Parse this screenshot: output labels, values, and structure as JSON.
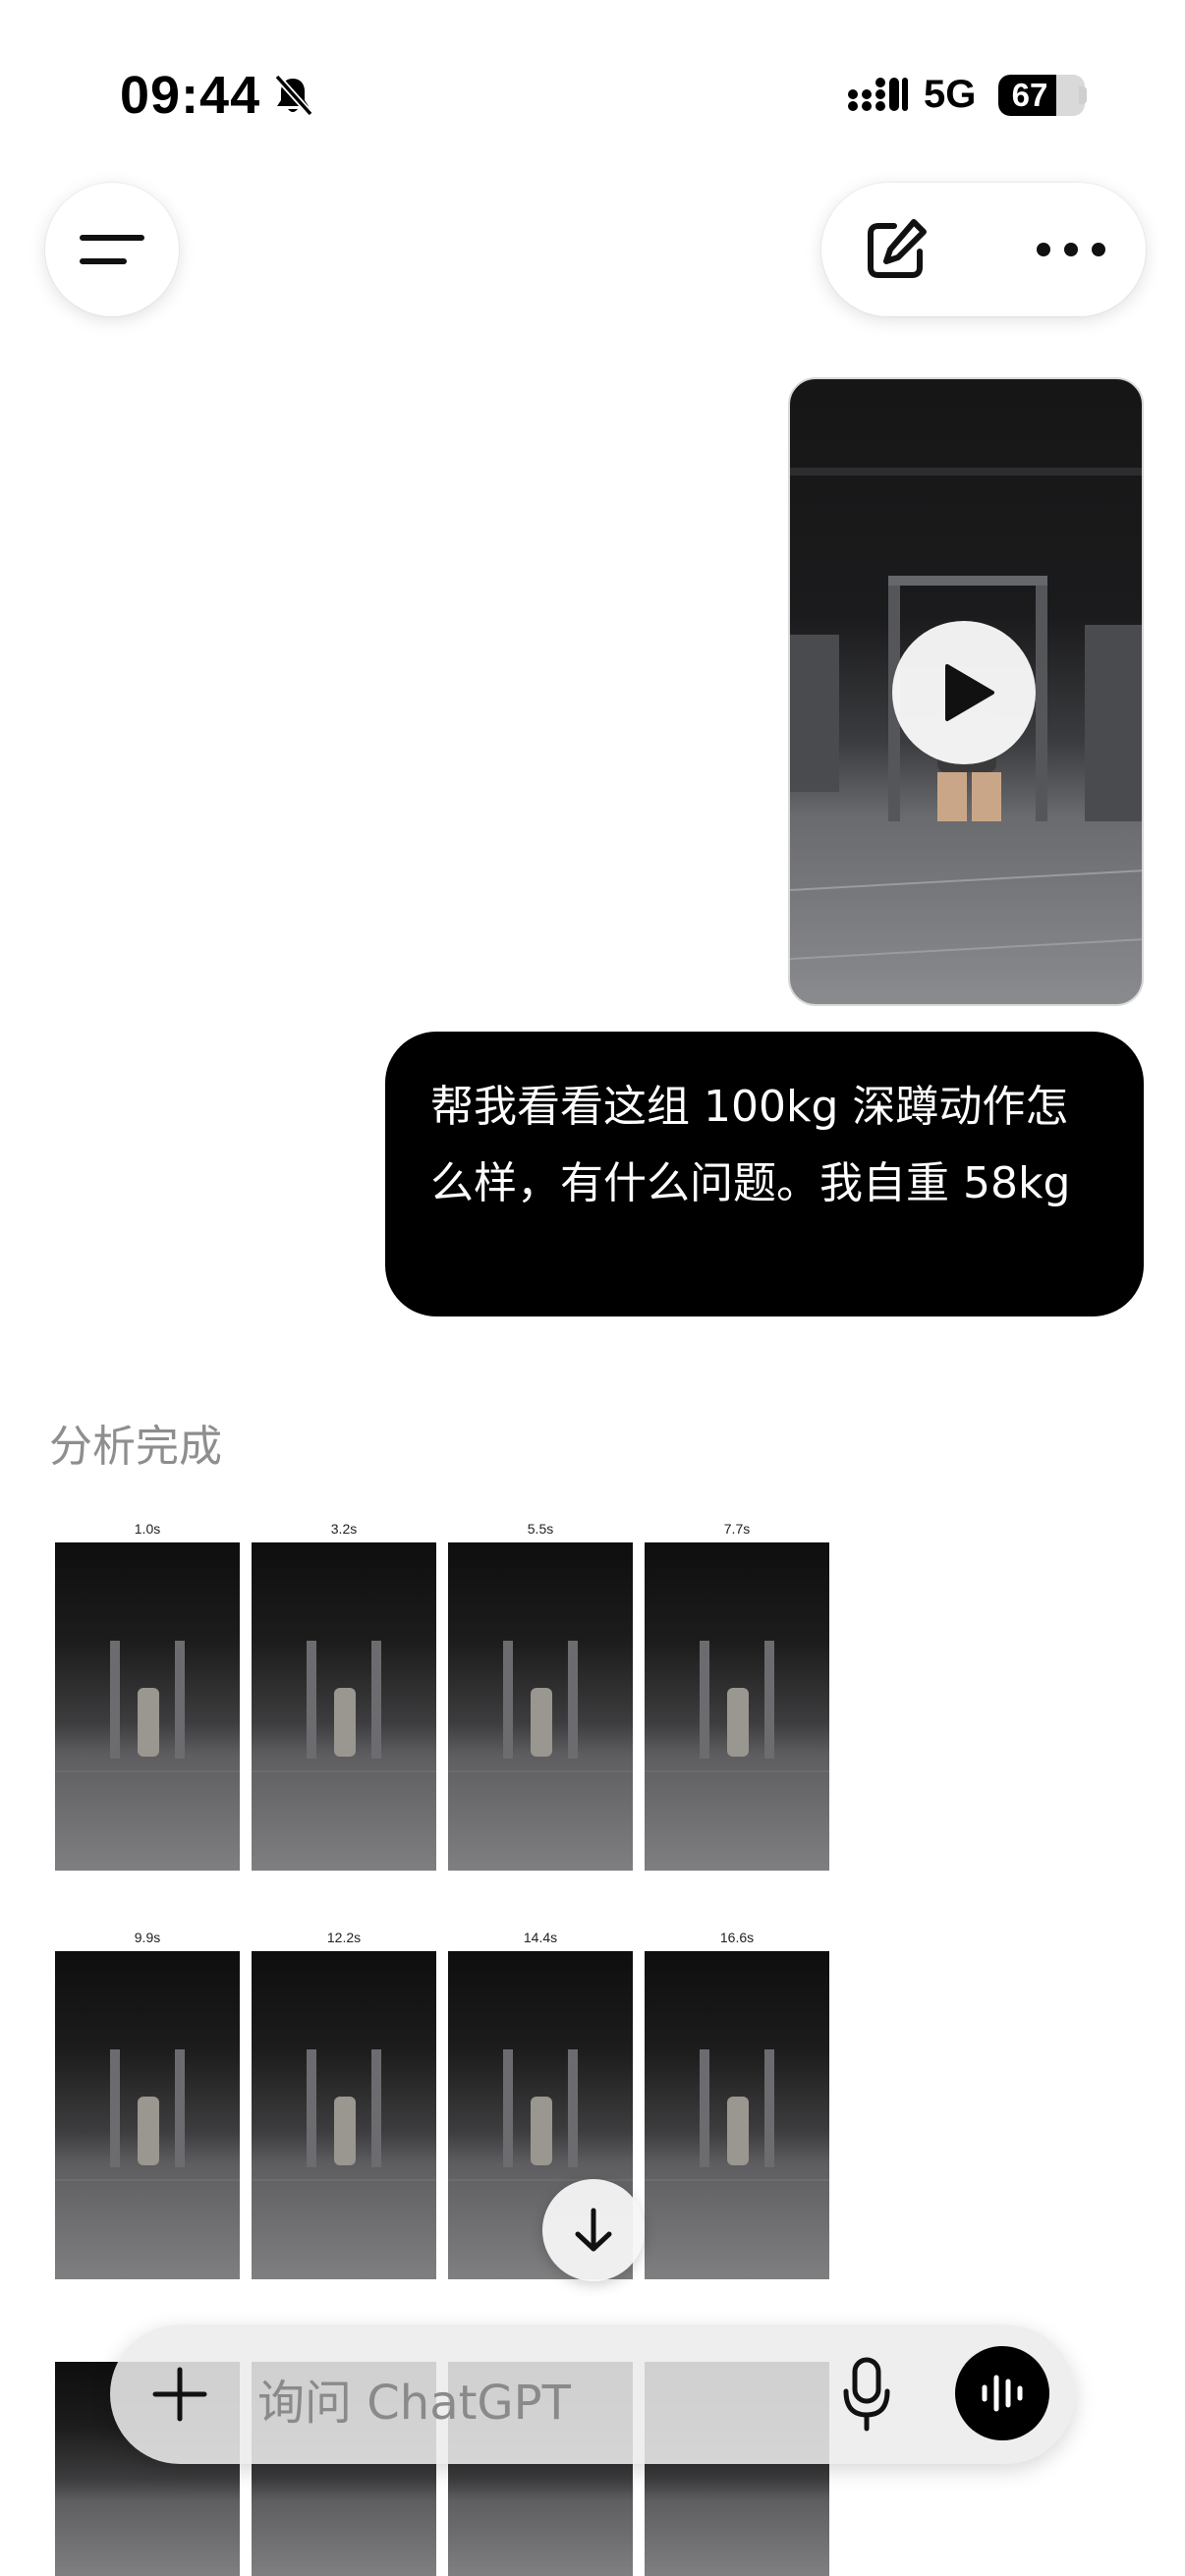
{
  "status_bar": {
    "time": "09:44",
    "network": "5G",
    "battery_level": "67",
    "battery_fraction": 0.67
  },
  "header": {
    "menu_icon": "hamburger-icon",
    "new_chat_icon": "edit-icon",
    "more_icon": "ellipsis-icon"
  },
  "conversation": {
    "attachment": {
      "type": "video",
      "play_icon": "play-icon"
    },
    "user_message": "帮我看看这组 100kg 深蹲动作怎么样，有什么问题。我自重 58kg",
    "assistant_status": "分析完成",
    "frames": [
      {
        "time": "1.0s"
      },
      {
        "time": "3.2s"
      },
      {
        "time": "5.5s"
      },
      {
        "time": "7.7s"
      },
      {
        "time": "9.9s"
      },
      {
        "time": "12.2s"
      },
      {
        "time": "14.4s"
      },
      {
        "time": "16.6s"
      }
    ]
  },
  "composer": {
    "placeholder": "询问 ChatGPT",
    "add_icon": "plus-icon",
    "mic_icon": "microphone-icon",
    "voice_icon": "voice-mode-icon"
  },
  "scroll_down_icon": "arrow-down-icon",
  "colors": {
    "user_bubble": "#000000",
    "status_text": "#8e8e8e",
    "background": "#ffffff"
  }
}
